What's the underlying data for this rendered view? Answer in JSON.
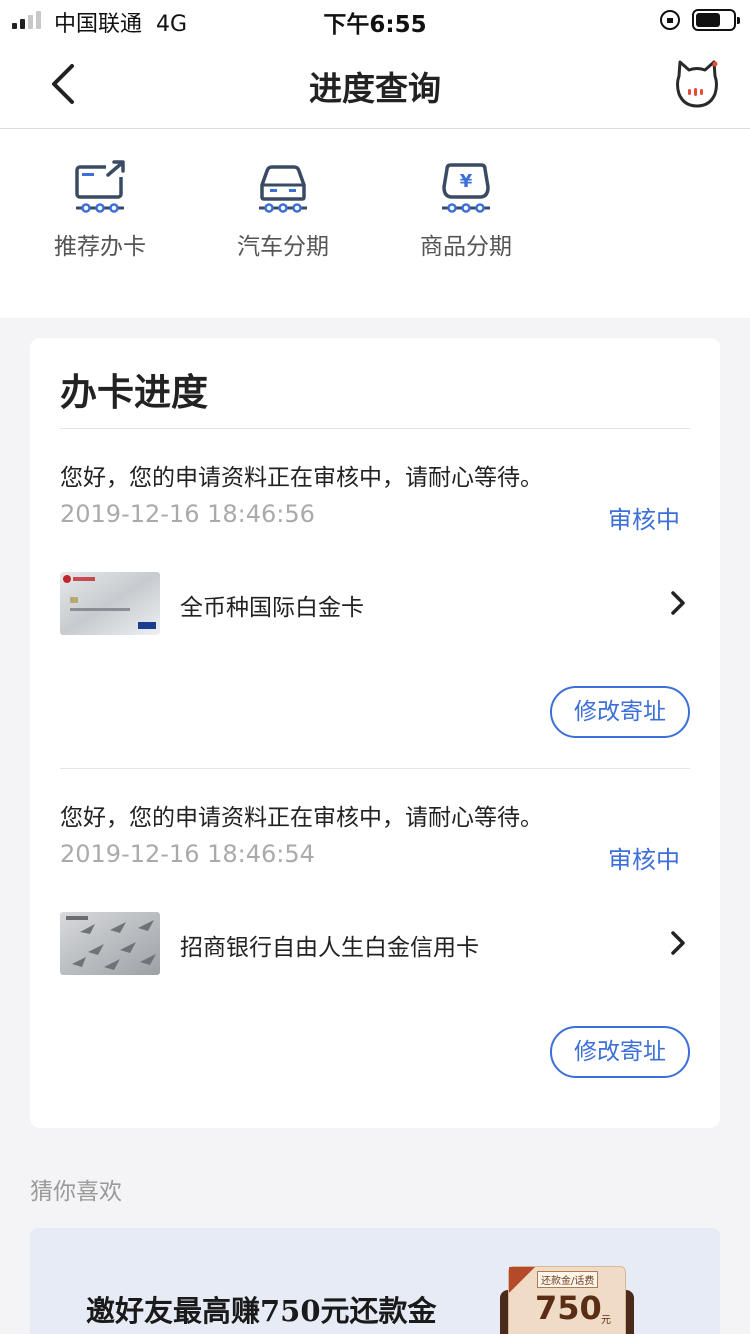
{
  "status_bar": {
    "carrier": "中国联通",
    "network": "4G",
    "time": "下午6:55"
  },
  "nav": {
    "title": "进度查询",
    "back_icon": "chevron-left-icon",
    "mascot_icon": "cat-mascot-icon"
  },
  "quick_menu": [
    {
      "label": "推荐办卡",
      "icon": "card-share-icon"
    },
    {
      "label": "汽车分期",
      "icon": "car-icon"
    },
    {
      "label": "商品分期",
      "icon": "yen-bag-icon"
    }
  ],
  "progress_card": {
    "title": "办卡进度",
    "applications": [
      {
        "message": "您好，您的申请资料正在审核中，请耐心等待。",
        "timestamp": "2019-12-16 18:46:56",
        "status": "审核中",
        "card_name": "全币种国际白金卡",
        "address_button": "修改寄址"
      },
      {
        "message": "您好，您的申请资料正在审核中，请耐心等待。",
        "timestamp": "2019-12-16 18:46:54",
        "status": "审核中",
        "card_name": "招商银行自由人生白金信用卡",
        "address_button": "修改寄址"
      }
    ]
  },
  "recommend": {
    "label": "猜你喜欢",
    "banner_headline": "邀好友最高赚750元还款金",
    "promo_tag": "还款金/话费",
    "promo_amount": "750",
    "promo_unit": "元"
  },
  "colors": {
    "accent": "#3c6fd9",
    "icon_stroke": "#3b4a63",
    "background": "#f4f4f6"
  }
}
